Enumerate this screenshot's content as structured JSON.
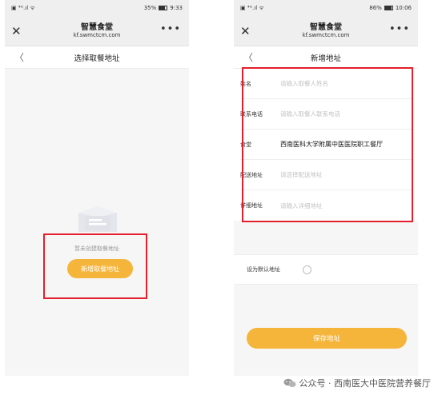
{
  "left": {
    "status": {
      "icons": "▣ ⁴ᴳ.ıl ᯤ",
      "battery": "35%",
      "time": "9:33"
    },
    "titlebar": {
      "close": "✕",
      "title": "智慧食堂",
      "url": "kf.swmctcm.com",
      "more": "•••"
    },
    "nav": {
      "back": "〈",
      "title": "选择取餐地址"
    },
    "empty_text": "暂未创建取餐地址",
    "add_button": "新增取餐地址"
  },
  "right": {
    "status": {
      "icons": "▣ ⁴ᴳ.ıl ᯤ",
      "battery": "86%",
      "time": "10:06"
    },
    "titlebar": {
      "close": "✕",
      "title": "智慧食堂",
      "url": "kf.swmctcm.com",
      "more": "•••"
    },
    "nav": {
      "back": "〈",
      "title": "新增地址"
    },
    "form": [
      {
        "label": "姓名",
        "value": "请输入取餐人姓名",
        "filled": false
      },
      {
        "label": "联系电话",
        "value": "请输入取餐人联系电话",
        "filled": false
      },
      {
        "label": "食堂",
        "value": "西南医科大学附属中医医院职工餐厅",
        "filled": true
      },
      {
        "label": "配送地址",
        "value": "请选择配送地址",
        "filled": false
      },
      {
        "label": "详细地址",
        "value": "请输入详细地址",
        "filled": false
      }
    ],
    "default_label": "设为默认地址",
    "save_button": "保存地址"
  },
  "watermark": "公众号 · 西南医大中医院营养餐厅",
  "colors": {
    "accent": "#f5b53b",
    "highlight": "#e3202b"
  }
}
